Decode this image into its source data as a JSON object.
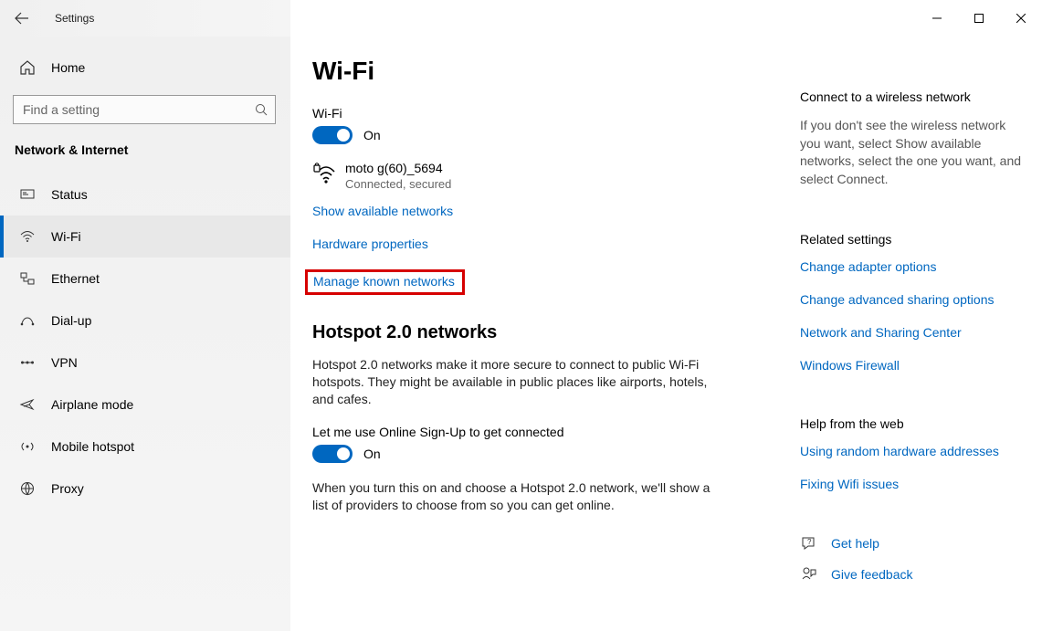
{
  "window": {
    "title": "Settings"
  },
  "sidebar": {
    "home": "Home",
    "search_placeholder": "Find a setting",
    "category": "Network & Internet",
    "items": [
      {
        "label": "Status"
      },
      {
        "label": "Wi-Fi"
      },
      {
        "label": "Ethernet"
      },
      {
        "label": "Dial-up"
      },
      {
        "label": "VPN"
      },
      {
        "label": "Airplane mode"
      },
      {
        "label": "Mobile hotspot"
      },
      {
        "label": "Proxy"
      }
    ]
  },
  "main": {
    "title": "Wi-Fi",
    "wifi_label": "Wi-Fi",
    "wifi_toggle_state": "On",
    "ssid": "moto g(60)_5694",
    "status": "Connected, secured",
    "links": {
      "show_available": "Show available networks",
      "hardware_props": "Hardware properties",
      "manage_known": "Manage known networks"
    },
    "hotspot": {
      "heading": "Hotspot 2.0 networks",
      "desc": "Hotspot 2.0 networks make it more secure to connect to public Wi-Fi hotspots. They might be available in public places like airports, hotels, and cafes.",
      "toggle_label": "Let me use Online Sign-Up to get connected",
      "toggle_state": "On",
      "desc2": "When you turn this on and choose a Hotspot 2.0 network, we'll show a list of providers to choose from so you can get online."
    }
  },
  "right": {
    "connect_heading": "Connect to a wireless network",
    "connect_text": "If you don't see the wireless network you want, select Show available networks, select the one you want, and select Connect.",
    "related_heading": "Related settings",
    "related_links": [
      "Change adapter options",
      "Change advanced sharing options",
      "Network and Sharing Center",
      "Windows Firewall"
    ],
    "help_heading": "Help from the web",
    "help_links": [
      "Using random hardware addresses",
      "Fixing Wifi issues"
    ],
    "get_help": "Get help",
    "feedback": "Give feedback"
  }
}
